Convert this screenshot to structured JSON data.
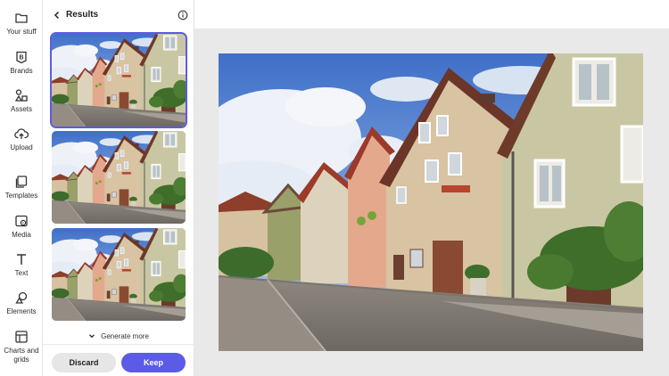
{
  "rail": {
    "items": [
      {
        "label": "Your stuff",
        "icon": "folder-icon"
      },
      {
        "label": "Brands",
        "icon": "brand-b-icon"
      },
      {
        "label": "Assets",
        "icon": "assets-icon"
      },
      {
        "label": "Upload",
        "icon": "upload-cloud-icon"
      },
      {
        "label": "Templates",
        "icon": "templates-icon"
      },
      {
        "label": "Media",
        "icon": "media-icon"
      },
      {
        "label": "Text",
        "icon": "text-t-icon"
      },
      {
        "label": "Elements",
        "icon": "elements-icon"
      },
      {
        "label": "Charts and grids",
        "icon": "charts-grid-icon"
      }
    ]
  },
  "panel": {
    "title": "Results",
    "generate_more": "Generate more",
    "discard_label": "Discard",
    "keep_label": "Keep",
    "selected_index": 0
  },
  "colors": {
    "accent": "#5b5be6",
    "canvas_bg": "#e9e9e9"
  }
}
